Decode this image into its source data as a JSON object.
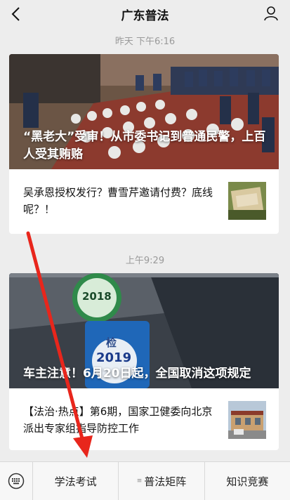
{
  "header": {
    "title": "广东普法",
    "back_icon": "back-chevron-icon",
    "user_icon": "user-profile-icon"
  },
  "messages": [
    {
      "timestamp": "昨天 下午6:16",
      "hero_title": "“黑老大”受审！从市委书记到普通民警，上百人受其贿赂",
      "sub_title": "吴承恩授权发行？曹雪芹邀请付费？底线呢？！"
    },
    {
      "timestamp": "上午9:29",
      "hero_title": "车主注意！6月20日起，全国取消这项规定",
      "sub_title": "【法治·热点】第6期，国家卫健委向北京派出专家组指导防控工作",
      "sticker_top": "2018",
      "sticker_bottom": "2019",
      "sticker_label": "检"
    }
  ],
  "bottom_menu": {
    "keyboard_icon": "keyboard-icon",
    "items": [
      {
        "label": "学法考试",
        "has_submenu": false
      },
      {
        "label": "普法矩阵",
        "has_submenu": true
      },
      {
        "label": "知识竞赛",
        "has_submenu": false
      }
    ]
  },
  "colors": {
    "background": "#ededed",
    "annotation_arrow": "#e8261c"
  }
}
